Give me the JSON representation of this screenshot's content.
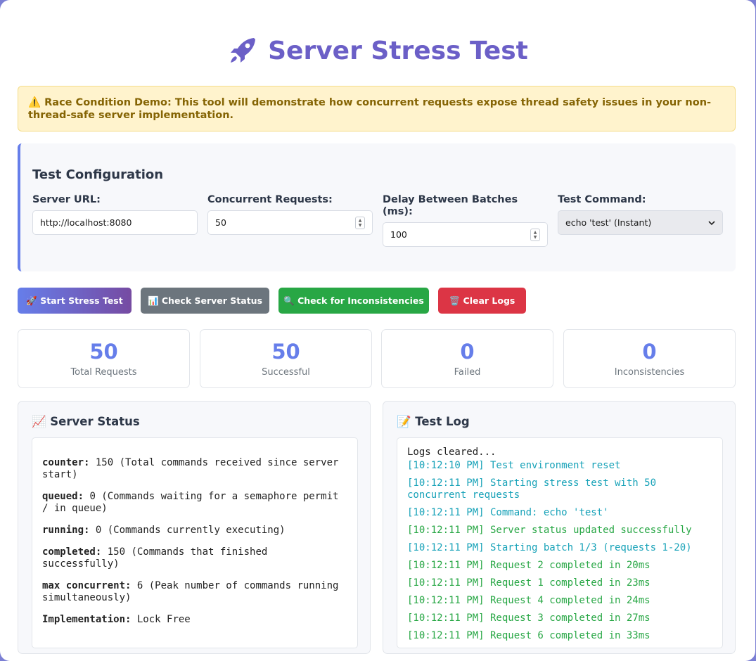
{
  "header": {
    "title": "Server Stress Test",
    "icon": "rocket-icon"
  },
  "warning": {
    "icon": "⚠️",
    "text": "Race Condition Demo: This tool will demonstrate how concurrent requests expose thread safety issues in your non-thread-safe server implementation."
  },
  "config": {
    "heading": "Test Configuration",
    "server_url_label": "Server URL:",
    "server_url_value": "http://localhost:8080",
    "concurrent_label": "Concurrent Requests:",
    "concurrent_value": "50",
    "delay_label": "Delay Between Batches (ms):",
    "delay_value": "100",
    "command_label": "Test Command:",
    "command_value": "echo 'test' (Instant)"
  },
  "buttons": {
    "start": "🚀 Start Stress Test",
    "status": "📊 Check Server Status",
    "inconsistencies": "🔍 Check for Inconsistencies",
    "clear": "🗑️ Clear Logs"
  },
  "stats": [
    {
      "value": "50",
      "label": "Total Requests"
    },
    {
      "value": "50",
      "label": "Successful"
    },
    {
      "value": "0",
      "label": "Failed"
    },
    {
      "value": "0",
      "label": "Inconsistencies"
    }
  ],
  "server_status": {
    "heading": "📈 Server Status",
    "lines": [
      {
        "key": "counter:",
        "text": " 150 (Total commands received since server start)"
      },
      {
        "key": "queued:",
        "text": " 0 (Commands waiting for a semaphore permit / in queue)"
      },
      {
        "key": "running:",
        "text": " 0 (Commands currently executing)"
      },
      {
        "key": "completed:",
        "text": " 150 (Commands that finished successfully)"
      },
      {
        "key": "max concurrent:",
        "text": " 6 (Peak number of commands running simultaneously)"
      },
      {
        "key": "Implementation:",
        "text": " Lock Free"
      }
    ]
  },
  "test_log": {
    "heading": "📝 Test Log",
    "lines": [
      "Logs cleared...",
      "[10:12:10 PM] Test environment reset",
      "[10:12:11 PM] Starting stress test with 50 concurrent requests",
      "[10:12:11 PM] Command: echo 'test'",
      "[10:12:11 PM] Server status updated successfully",
      "[10:12:11 PM] Starting batch 1/3 (requests 1-20)",
      "[10:12:11 PM] Request 2 completed in 20ms",
      "[10:12:11 PM] Request 1 completed in 23ms",
      "[10:12:11 PM] Request 4 completed in 24ms",
      "[10:12:11 PM] Request 3 completed in 27ms",
      "[10:12:11 PM] Request 6 completed in 33ms"
    ]
  },
  "colors": {
    "accent": "#667eea",
    "title": "#6b5fc7",
    "secondary": "#6c757d",
    "success": "#28a745",
    "danger": "#dc3545",
    "info": "#17a2b8"
  }
}
